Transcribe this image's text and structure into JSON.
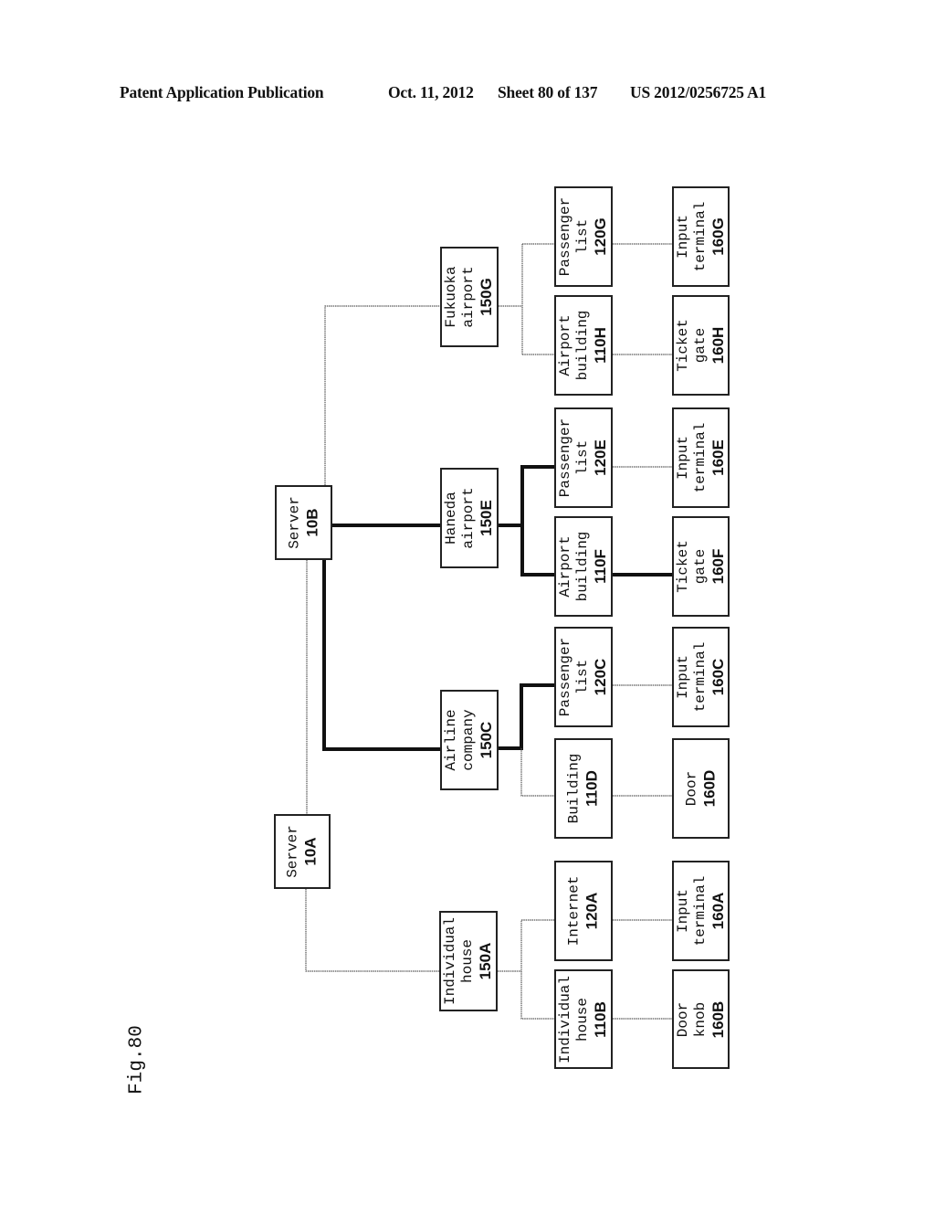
{
  "header": {
    "publication": "Patent Application Publication",
    "date": "Oct. 11, 2012",
    "sheet": "Sheet 80 of 137",
    "number": "US 2012/0256725 A1"
  },
  "figure_label": "Fig.80",
  "nodes": {
    "server_10b": {
      "lines": [
        "Server"
      ],
      "code": "10B"
    },
    "server_10a": {
      "lines": [
        "Server"
      ],
      "code": "10A"
    },
    "fukuoka_150g": {
      "lines": [
        "Fukuoka",
        "airport"
      ],
      "code": "150G"
    },
    "haneda_150e": {
      "lines": [
        "Haneda",
        "airport"
      ],
      "code": "150E"
    },
    "airline_150c": {
      "lines": [
        "Airline",
        "company"
      ],
      "code": "150C"
    },
    "house_150a": {
      "lines": [
        "Individual",
        "house"
      ],
      "code": "150A"
    },
    "plist_120g": {
      "lines": [
        "Passenger",
        "list"
      ],
      "code": "120G"
    },
    "abldg_110h": {
      "lines": [
        "Airport",
        "building"
      ],
      "code": "110H"
    },
    "plist_120e": {
      "lines": [
        "Passenger",
        "list"
      ],
      "code": "120E"
    },
    "abldg_110f": {
      "lines": [
        "Airport",
        "building"
      ],
      "code": "110F"
    },
    "plist_120c": {
      "lines": [
        "Passenger",
        "list"
      ],
      "code": "120C"
    },
    "bldg_110d": {
      "lines": [
        "Building"
      ],
      "code": "110D"
    },
    "internet_120a": {
      "lines": [
        "Internet"
      ],
      "code": "120A"
    },
    "house_110b": {
      "lines": [
        "Individual",
        "house"
      ],
      "code": "110B"
    },
    "input_160g": {
      "lines": [
        "Input",
        "terminal"
      ],
      "code": "160G"
    },
    "ticket_160h": {
      "lines": [
        "Ticket",
        "gate"
      ],
      "code": "160H"
    },
    "input_160e": {
      "lines": [
        "Input",
        "terminal"
      ],
      "code": "160E"
    },
    "ticket_160f": {
      "lines": [
        "Ticket",
        "gate"
      ],
      "code": "160F"
    },
    "input_160c": {
      "lines": [
        "Input",
        "terminal"
      ],
      "code": "160C"
    },
    "door_160d": {
      "lines": [
        "Door"
      ],
      "code": "160D"
    },
    "input_160a": {
      "lines": [
        "Input",
        "terminal"
      ],
      "code": "160A"
    },
    "knob_160b": {
      "lines": [
        "Door",
        "knob"
      ],
      "code": "160B"
    }
  },
  "connections": [
    {
      "from": "server_10b",
      "to": "fukuoka_150g",
      "style": "thin"
    },
    {
      "from": "server_10b",
      "to": "haneda_150e",
      "style": "thick"
    },
    {
      "from": "server_10b",
      "to": "airline_150c",
      "style": "thick"
    },
    {
      "from": "server_10b",
      "to": "server_10a",
      "style": "thin"
    },
    {
      "from": "server_10a",
      "to": "house_150a",
      "style": "thin"
    },
    {
      "from": "fukuoka_150g",
      "to": "plist_120g",
      "style": "thin"
    },
    {
      "from": "fukuoka_150g",
      "to": "abldg_110h",
      "style": "thin"
    },
    {
      "from": "haneda_150e",
      "to": "plist_120e",
      "style": "thick"
    },
    {
      "from": "haneda_150e",
      "to": "abldg_110f",
      "style": "thick"
    },
    {
      "from": "airline_150c",
      "to": "plist_120c",
      "style": "thick"
    },
    {
      "from": "airline_150c",
      "to": "bldg_110d",
      "style": "thin"
    },
    {
      "from": "house_150a",
      "to": "internet_120a",
      "style": "thin"
    },
    {
      "from": "house_150a",
      "to": "house_110b",
      "style": "thin"
    },
    {
      "from": "plist_120g",
      "to": "input_160g",
      "style": "thin"
    },
    {
      "from": "abldg_110h",
      "to": "ticket_160h",
      "style": "thin"
    },
    {
      "from": "plist_120e",
      "to": "input_160e",
      "style": "thin"
    },
    {
      "from": "abldg_110f",
      "to": "ticket_160f",
      "style": "thick"
    },
    {
      "from": "plist_120c",
      "to": "input_160c",
      "style": "thin"
    },
    {
      "from": "bldg_110d",
      "to": "door_160d",
      "style": "thin"
    },
    {
      "from": "internet_120a",
      "to": "input_160a",
      "style": "thin"
    },
    {
      "from": "house_110b",
      "to": "knob_160b",
      "style": "thin"
    }
  ]
}
